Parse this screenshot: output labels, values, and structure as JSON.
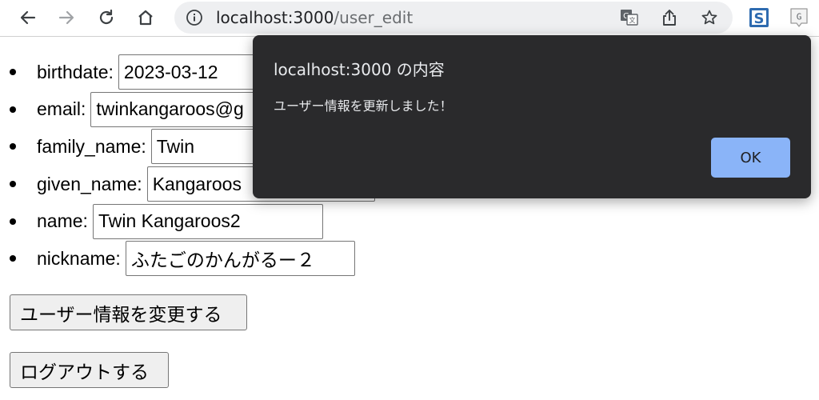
{
  "browser": {
    "url_host": "localhost:3000",
    "url_path": "/user_edit"
  },
  "icons": {
    "back": "back-arrow-icon",
    "forward": "forward-arrow-icon",
    "reload": "reload-icon",
    "home": "home-icon",
    "info": "info-icon",
    "translate": "translate-icon",
    "share": "share-icon",
    "bookmark": "star-icon",
    "ext1": "s-extension-icon",
    "ext2": "g-extension-icon"
  },
  "form": {
    "fields": [
      {
        "label": "birthdate:",
        "value": "2023-03-12"
      },
      {
        "label": "email:",
        "value": "twinkangaroos@g"
      },
      {
        "label": "family_name:",
        "value": "Twin"
      },
      {
        "label": "given_name:",
        "value": "Kangaroos"
      },
      {
        "label": "name:",
        "value": "Twin Kangaroos2"
      },
      {
        "label": "nickname:",
        "value": "ふたごのかんがるー２"
      }
    ],
    "update_button": "ユーザー情報を変更する",
    "logout_button": "ログアウトする"
  },
  "dialog": {
    "title": "localhost:3000 の内容",
    "message": "ユーザー情報を更新しました！",
    "ok_label": "OK"
  },
  "colors": {
    "dialog_bg": "#2a2a2c",
    "ok_button": "#8ab4f8",
    "omnibox_bg": "#eeeff1"
  }
}
